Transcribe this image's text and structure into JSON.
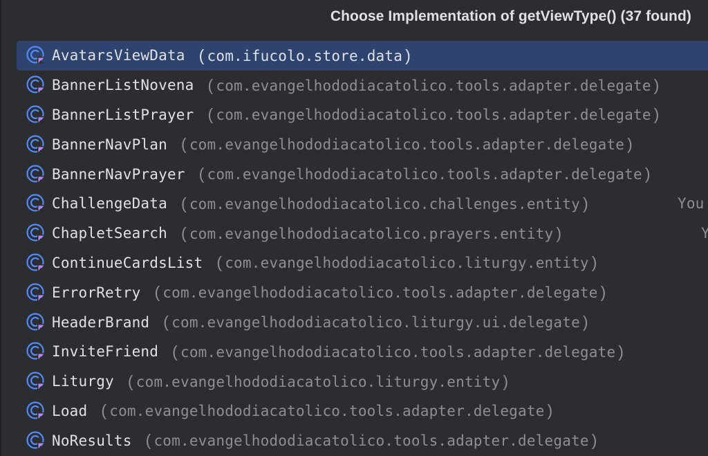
{
  "popup": {
    "title": "Choose Implementation of getViewType() (37 found)"
  },
  "items": [
    {
      "name": "AvatarsViewData",
      "package": "com.ifucolo.store.data",
      "extra": ""
    },
    {
      "name": "BannerListNovena",
      "package": "com.evangelhododiacatolico.tools.adapter.delegate",
      "extra": ""
    },
    {
      "name": "BannerListPrayer",
      "package": "com.evangelhododiacatolico.tools.adapter.delegate",
      "extra": ""
    },
    {
      "name": "BannerNavPlan",
      "package": "com.evangelhododiacatolico.tools.adapter.delegate",
      "extra": ""
    },
    {
      "name": "BannerNavPrayer",
      "package": "com.evangelhododiacatolico.tools.adapter.delegate",
      "extra": ""
    },
    {
      "name": "ChallengeData",
      "package": "com.evangelhododiacatolico.challenges.entity",
      "extra": "You"
    },
    {
      "name": "ChapletSearch",
      "package": "com.evangelhododiacatolico.prayers.entity",
      "extra": "Y"
    },
    {
      "name": "ContinueCardsList",
      "package": "com.evangelhododiacatolico.liturgy.entity",
      "extra": ""
    },
    {
      "name": "ErrorRetry",
      "package": "com.evangelhododiacatolico.tools.adapter.delegate",
      "extra": ""
    },
    {
      "name": "HeaderBrand",
      "package": "com.evangelhododiacatolico.liturgy.ui.delegate",
      "extra": ""
    },
    {
      "name": "InviteFriend",
      "package": "com.evangelhododiacatolico.tools.adapter.delegate",
      "extra": ""
    },
    {
      "name": "Liturgy",
      "package": "com.evangelhododiacatolico.liturgy.entity",
      "extra": ""
    },
    {
      "name": "Load",
      "package": "com.evangelhododiacatolico.tools.adapter.delegate",
      "extra": ""
    },
    {
      "name": "NoResults",
      "package": "com.evangelhododiacatolico.tools.adapter.delegate",
      "extra": ""
    }
  ],
  "icon": "kotlin-class-icon",
  "colors": {
    "background": "#2b2d30",
    "selection": "#2e436e",
    "icon_blue": "#548af7",
    "icon_purple": "#b189f5",
    "text_primary": "#dfe1e5",
    "text_secondary": "#8c8f94"
  }
}
